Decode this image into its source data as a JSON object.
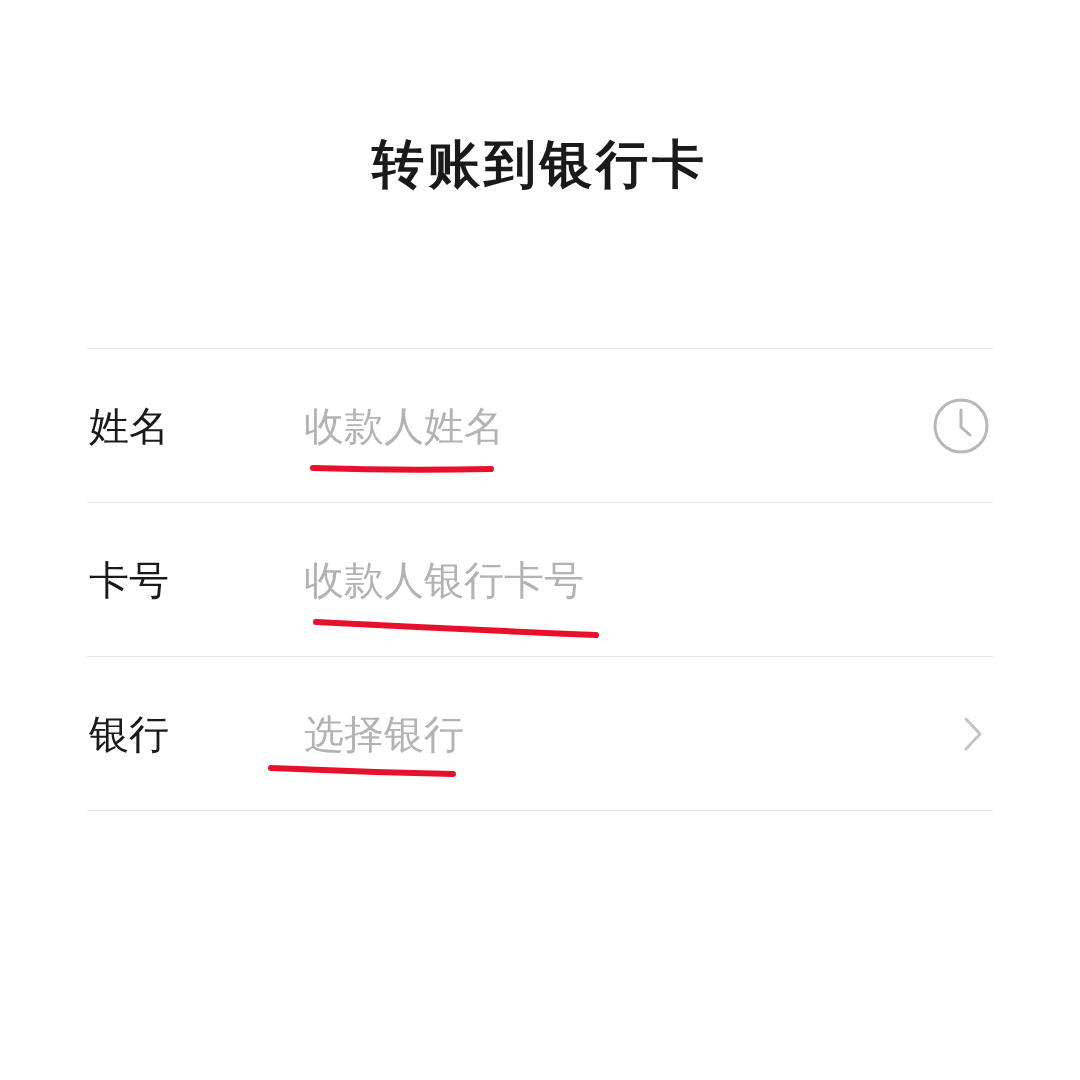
{
  "title": "转账到银行卡",
  "fields": [
    {
      "label": "姓名",
      "placeholder": "收款人姓名",
      "kind": "history",
      "marked": true
    },
    {
      "label": "卡号",
      "placeholder": "收款人银行卡号",
      "kind": "text",
      "marked": true
    },
    {
      "label": "银行",
      "placeholder": "选择银行",
      "kind": "chevron",
      "marked": true
    }
  ]
}
